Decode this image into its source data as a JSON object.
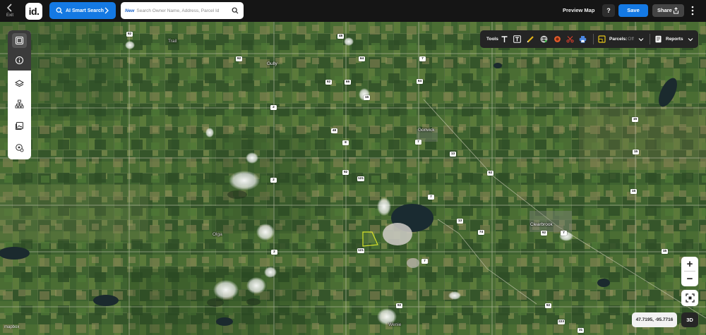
{
  "header": {
    "exit_label": "Exit",
    "logo_text": "id.",
    "ai_search_label": "AI Smart Search",
    "search_new_tag": "New",
    "search_placeholder": "Search Owner Name, Address, Parcel Id",
    "preview_map_label": "Preview Map",
    "help_label": "?",
    "save_label": "Save",
    "share_label": "Share"
  },
  "toolbar": {
    "tools_label": "Tools",
    "parcels_label": "Parcels:",
    "parcels_state": "Off",
    "reports_label": "Reports"
  },
  "sidebar": {
    "items": [
      {
        "icon": "layout-icon"
      },
      {
        "icon": "info-icon"
      },
      {
        "icon": "layers-icon"
      },
      {
        "icon": "hierarchy-icon"
      },
      {
        "icon": "image-gallery-icon"
      },
      {
        "icon": "location-settings-icon"
      }
    ]
  },
  "map": {
    "places": [
      {
        "name": "Gully"
      },
      {
        "name": "Gonvick"
      },
      {
        "name": "Clearbrook"
      },
      {
        "name": "Trail"
      },
      {
        "name": "Olga"
      },
      {
        "name": "Wenie"
      }
    ],
    "shields": [
      "92",
      "48",
      "92",
      "64",
      "7",
      "92",
      "66",
      "64",
      "15",
      "2",
      "48",
      "8",
      "7",
      "13",
      "92",
      "92",
      "15",
      "2",
      "121",
      "7",
      "15",
      "13",
      "74",
      "92",
      "2",
      "7",
      "15",
      "121",
      "15",
      "7",
      "92",
      "92",
      "223",
      "31"
    ],
    "coordinates": "47.7195, -95.7716",
    "attribution": "mapbox",
    "zoom_in": "+",
    "zoom_out": "−",
    "three_d_label": "3D"
  },
  "colors": {
    "primary_blue": "#1479e3",
    "topbar": "#151515",
    "parcel_highlight": "#d8e22a"
  }
}
